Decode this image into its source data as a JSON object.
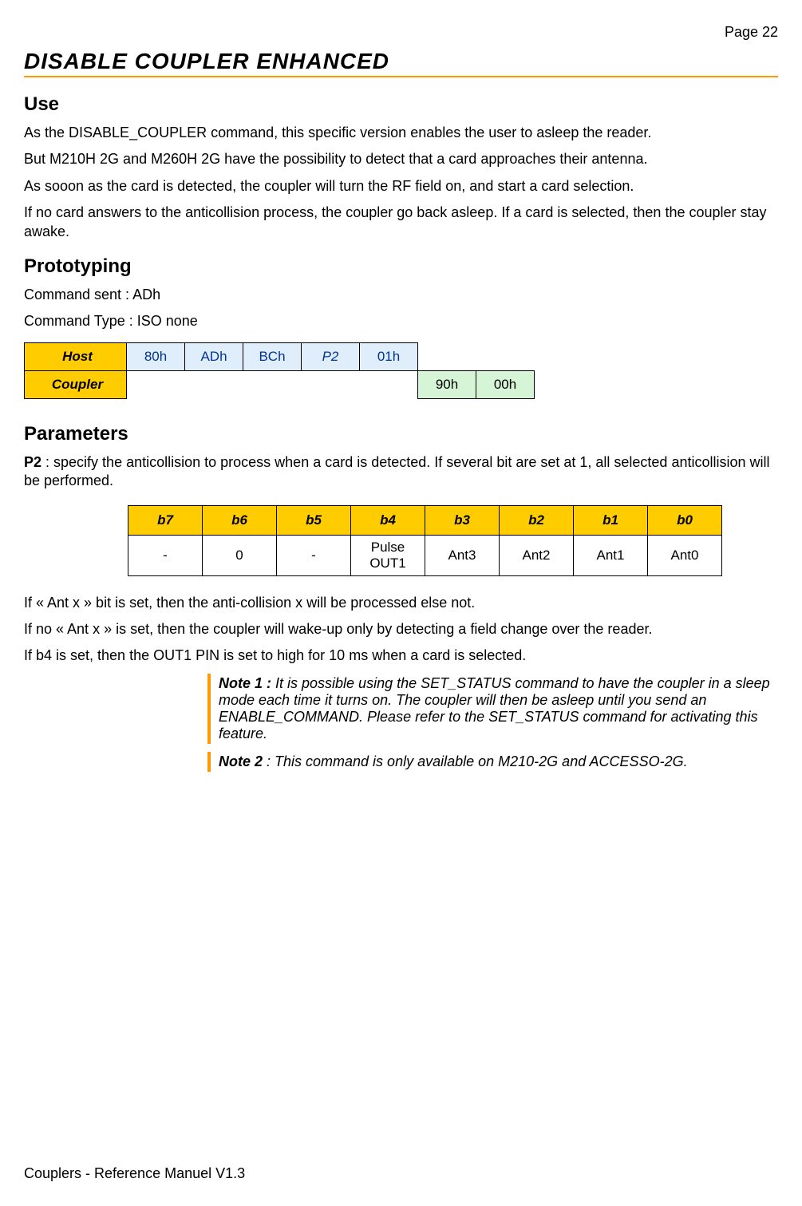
{
  "page_number": "Page 22",
  "title": "DISABLE COUPLER ENHANCED",
  "sections": {
    "use": {
      "heading": "Use",
      "p1": "As the DISABLE_COUPLER command, this specific version enables the user to asleep the reader.",
      "p2": "But M210H 2G and M260H 2G have the possibility to detect that a card approaches their antenna.",
      "p3": "As sooon as the card is detected, the coupler will turn the RF field on, and start a card selection.",
      "p4": "If no card answers to the anticollision process, the coupler go back asleep. If a card is selected, then the coupler stay awake."
    },
    "prototyping": {
      "heading": "Prototyping",
      "command_sent": "Command sent : ADh",
      "command_type": "Command Type : ISO none",
      "host_label": "Host",
      "coupler_label": "Coupler",
      "host": [
        "80h",
        "ADh",
        "BCh",
        "P2",
        "01h"
      ],
      "coupler": [
        "90h",
        "00h"
      ]
    },
    "parameters": {
      "heading": "Parameters",
      "p1_prefix": "P2",
      "p1_rest": " : specify the anticollision to process when a card is detected. If several bit are set at 1, all selected anticollision will be performed.",
      "bits_header": [
        "b7",
        "b6",
        "b5",
        "b4",
        "b3",
        "b2",
        "b1",
        "b0"
      ],
      "bits_row": [
        "-",
        "0",
        "-",
        "Pulse OUT1",
        "Ant3",
        "Ant2",
        "Ant1",
        "Ant0"
      ],
      "p2": "If « Ant x » bit is set, then the anti-collision x will be processed else not.",
      "p3": "If no « Ant x » is set, then the coupler will wake-up only by detecting a field change over the reader.",
      "p4": "If b4 is set, then the OUT1 PIN is set to high for 10 ms when a card is selected.",
      "note1_label": "Note 1 :",
      "note1_text": " It is possible using the SET_STATUS command to have the coupler in a sleep mode each time it turns on. The coupler will then be asleep until you send an ENABLE_COMMAND. Please refer to the SET_STATUS command for activating this feature.",
      "note2_label": "Note 2",
      "note2_text": " : This command is only available on M210-2G and ACCESSO-2G."
    }
  },
  "footer": "Couplers - Reference Manuel V1.3"
}
